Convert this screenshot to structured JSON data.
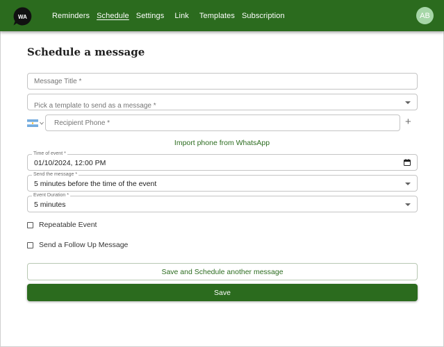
{
  "nav": {
    "logo_text": "WA",
    "links": [
      "Reminders",
      "Schedule",
      "Settings",
      "Link",
      "Templates",
      "Subscription"
    ],
    "active": "Schedule",
    "avatar_initials": "AB"
  },
  "page": {
    "title": "Schedule a message"
  },
  "form": {
    "message_title_placeholder": "Message Title *",
    "template_placeholder": "Pick a template to send as a message *",
    "recipient_phone_placeholder": "Recipient Phone *",
    "import_link": "Import phone from WhatsApp",
    "time_of_event": {
      "label": "Time of event *",
      "value": "01/10/2024, 12:00 PM"
    },
    "send_message": {
      "label": "Send the message *",
      "value": "5 minutes before the time of the event"
    },
    "event_duration": {
      "label": "Event Duration *",
      "value": "5 minutes"
    },
    "repeatable_label": "Repeatable Event",
    "follow_up_label": "Send a Follow Up Message",
    "save_another_label": "Save and Schedule another message",
    "save_label": "Save"
  },
  "colors": {
    "brand": "#2b6b1e",
    "avatar": "#a5d6a7"
  },
  "icons": [
    "whatsapp-logo-icon",
    "argentina-flag-icon",
    "chevron-down-icon",
    "plus-icon",
    "calendar-icon"
  ]
}
